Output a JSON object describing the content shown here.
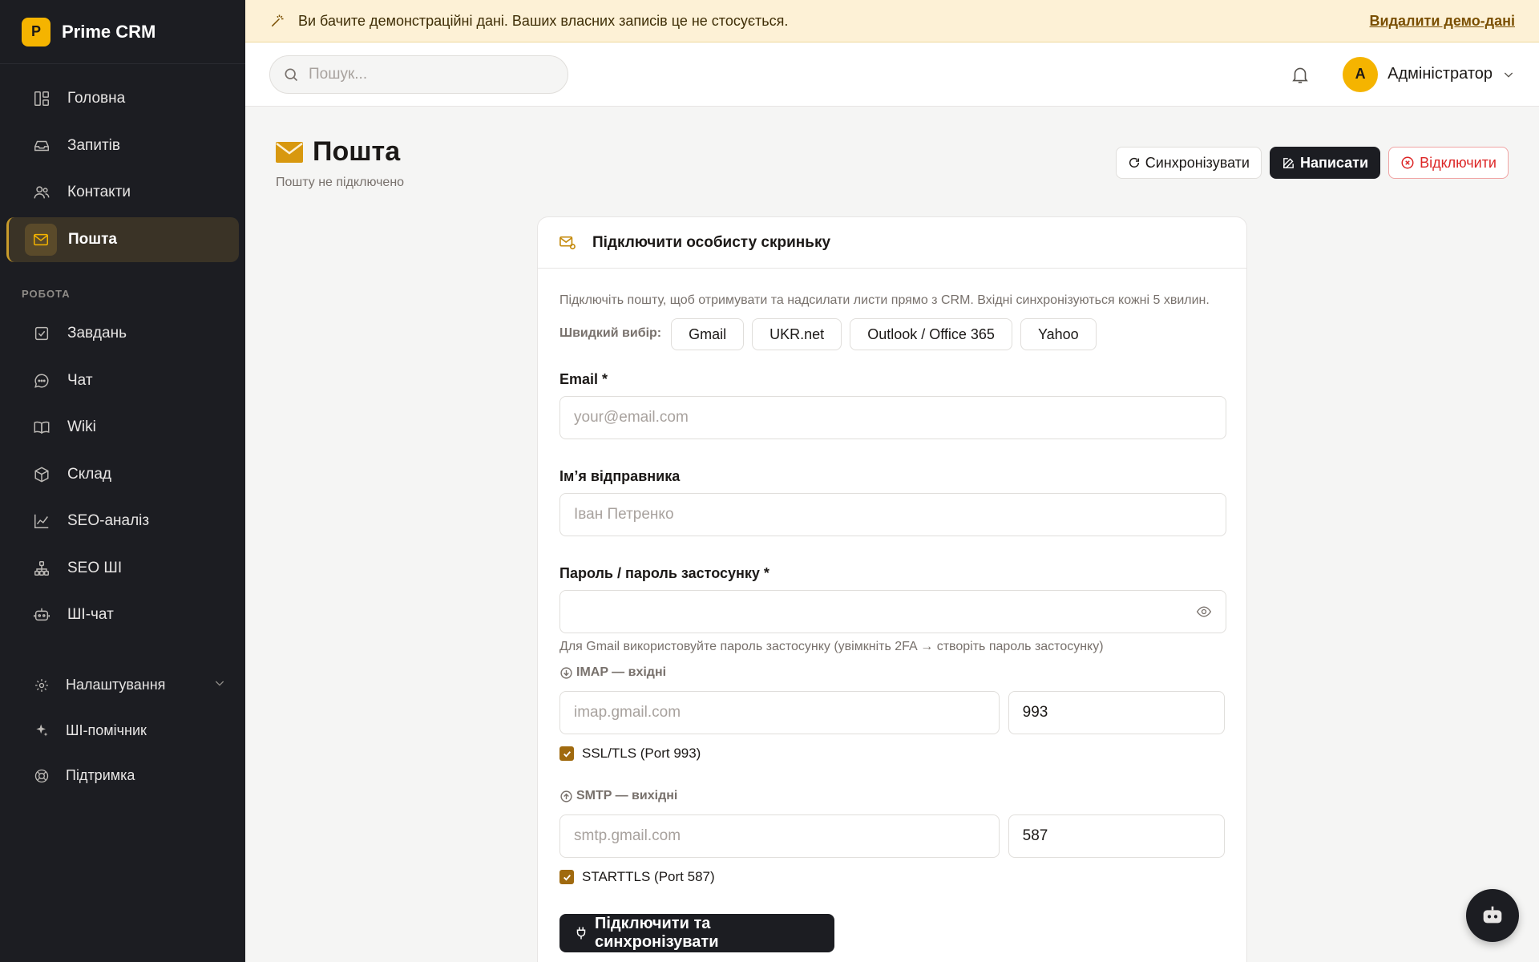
{
  "brand": {
    "logo_letter": "P",
    "name": "Prime CRM",
    "accent": "#f5b400"
  },
  "sidebar": {
    "main_items": [
      {
        "label": "Головна",
        "icon": "dashboard-icon"
      },
      {
        "label": "Запитів",
        "icon": "inbox-icon"
      },
      {
        "label": "Контакти",
        "icon": "users-icon"
      },
      {
        "label": "Пошта",
        "icon": "mail-icon",
        "active": true
      }
    ],
    "section_title": "РОБОТА",
    "work_items": [
      {
        "label": "Завдань",
        "icon": "checkbox-icon"
      },
      {
        "label": "Чат",
        "icon": "chat-icon"
      },
      {
        "label": "Wiki",
        "icon": "book-icon"
      },
      {
        "label": "Склад",
        "icon": "box-icon"
      },
      {
        "label": "SEO-аналіз",
        "icon": "chart-icon"
      },
      {
        "label": "SEO ШІ",
        "icon": "network-icon"
      },
      {
        "label": "ШІ-чат",
        "icon": "robot-icon"
      }
    ],
    "bottom_items": [
      {
        "label": "Налаштування",
        "icon": "gear-icon"
      },
      {
        "label": "ШІ-помічник",
        "icon": "sparkle-icon"
      },
      {
        "label": "Підтримка",
        "icon": "lifebuoy-icon"
      }
    ]
  },
  "banner": {
    "text": "Ви бачите демонстраційні дані. Ваших власних записів це не стосується.",
    "action": "Видалити демо-дані"
  },
  "topbar": {
    "search_placeholder": "Пошук...",
    "user_initial": "А",
    "user_name": "Адміністратор"
  },
  "page": {
    "title": "Пошта",
    "subtitle": "Пошту не підключено",
    "actions": {
      "sync": "Синхронізувати",
      "compose": "Написати",
      "disconnect": "Відключити"
    }
  },
  "card": {
    "title": "Підключити особисту скриньку",
    "description": "Підключіть пошту, щоб отримувати та надсилати листи прямо з CRM. Вхідні синхронізуються кожні 5 хвилин.",
    "quick_label": "Швидкий вибір:",
    "quick_options": [
      "Gmail",
      "UKR.net",
      "Outlook / Office 365",
      "Yahoo"
    ],
    "email_label": "Email *",
    "email_placeholder": "your@email.com",
    "sender_label": "Ім’я відправника",
    "sender_placeholder": "Іван Петренко",
    "password_label": "Пароль / пароль застосунку *",
    "password_hint": "Для Gmail використовуйте пароль застосунку (увімкніть 2FA → створіть пароль застосунку)",
    "imap_label": "IMAP — вхідні",
    "imap_host_placeholder": "imap.gmail.com",
    "imap_port": "993",
    "imap_ssl_label": "SSL/TLS (Port 993)",
    "smtp_label": "SMTP — вихідні",
    "smtp_host_placeholder": "smtp.gmail.com",
    "smtp_port": "587",
    "smtp_tls_label": "STARTTLS (Port 587)",
    "submit": "Підключити та синхронізувати"
  }
}
